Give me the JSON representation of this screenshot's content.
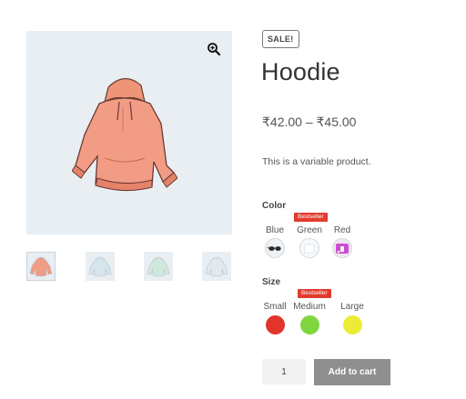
{
  "product": {
    "sale_badge": "SALE!",
    "title": "Hoodie",
    "price_range": "₹42.00 – ₹45.00",
    "short_description": "This is a variable product."
  },
  "gallery": {
    "main_image_icon": "hoodie-image",
    "zoom_icon": "magnify-plus-icon",
    "thumbnails": [
      {
        "icon": "hoodie-thumb",
        "color": "#ef9d84"
      },
      {
        "icon": "hoodie-thumb",
        "color": "#d6e4ee"
      },
      {
        "icon": "hoodie-thumb",
        "color": "#cfe8dd"
      },
      {
        "icon": "hoodie-thumb",
        "color": "#e2e9ee"
      }
    ]
  },
  "attributes": {
    "color": {
      "label": "Color",
      "options": [
        {
          "name": "Blue",
          "swatch_icon": "sunglasses-image"
        },
        {
          "name": "Green",
          "badge": "Bestseller",
          "swatch_icon": "white-product-image"
        },
        {
          "name": "Red",
          "swatch_icon": "pink-product-image"
        }
      ]
    },
    "size": {
      "label": "Size",
      "options": [
        {
          "name": "Small",
          "color": "#e0342c"
        },
        {
          "name": "Medium",
          "badge": "Bestseller",
          "color": "#7fd63e"
        },
        {
          "name": "Large",
          "color": "#ecec37"
        }
      ]
    }
  },
  "cart": {
    "quantity": "1",
    "add_to_cart_label": "Add to cart"
  }
}
